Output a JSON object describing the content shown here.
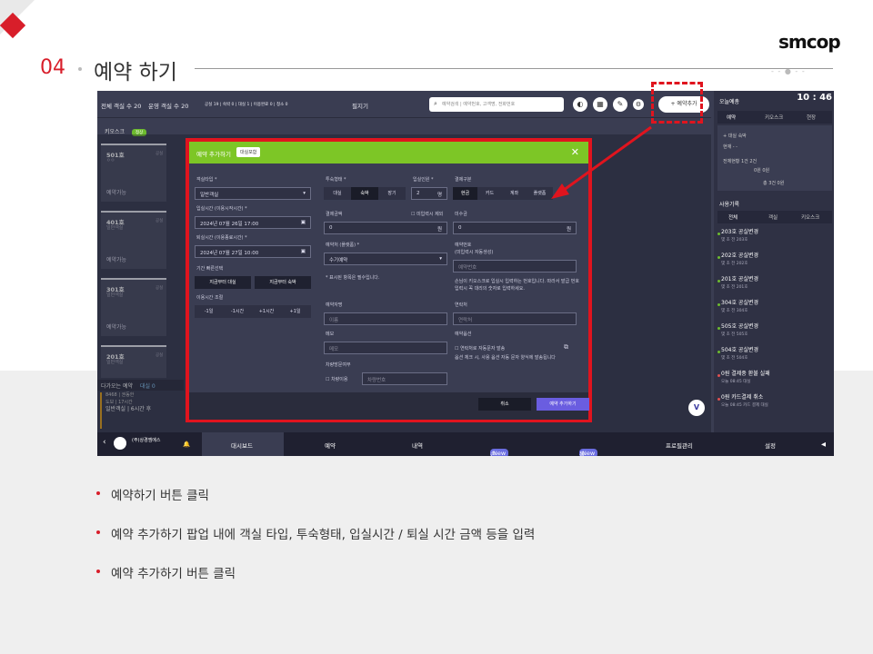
{
  "header": {
    "section_number": "04",
    "section_title": "예약 하기",
    "logo": "smcop"
  },
  "shot": {
    "topbar": {
      "total_rooms": "전체 객실 수 20",
      "operating_rooms": "운영 객실 수 20",
      "stats": "공실 19 | 숙박 0 | 대실 1 | 이용완료 0 | 청소 0",
      "filter": "필지기",
      "search_placeholder": "예약검색 | 예약번호, 고객명, 전화번호",
      "add_reservation": "+ 예약추가"
    },
    "kiosk": {
      "label": "키오스크",
      "badge": "정상"
    },
    "rooms": [
      {
        "no": "501호",
        "type": "ㅇㅇ",
        "state": "공실",
        "status": "예약가능"
      },
      {
        "no": "401호",
        "type": "일반객실",
        "state": "공실",
        "status": "예약가능"
      },
      {
        "no": "301호",
        "type": "일반객실",
        "state": "공실",
        "status": "예약가능"
      },
      {
        "no": "201호",
        "type": "일반객실",
        "state": "공실",
        "status": ""
      }
    ],
    "upcoming": {
      "label": "다가오는 예약",
      "count": "대실 0",
      "lines": [
        "8468 | 권동한",
        "도보 | 17시간",
        "일반객실 | 6시간 후"
      ]
    },
    "nav": {
      "company": "(주)상경엠에스",
      "items": [
        "대시보드",
        "예약",
        "내역",
        "손익",
        "통계",
        "프로필관리",
        "설정"
      ],
      "new_badge": "New"
    },
    "right": {
      "today": "오늘예총",
      "clock": "10 : 46",
      "tabs": [
        "예약",
        "키오스크",
        "현장"
      ],
      "table_rows": [
        "+ 대실 숙박",
        "현재 - -",
        "전체현황 1건 2건",
        "0원 0원",
        "총 3건 0원"
      ],
      "history_title": "사용기록",
      "history_tabs": [
        "전체",
        "객실",
        "키오스크"
      ],
      "history": [
        {
          "title": "203호 공실변경",
          "sub": "몇 초 전  203호"
        },
        {
          "title": "202호 공실변경",
          "sub": "몇 초 전  202호"
        },
        {
          "title": "201호 공실변경",
          "sub": "몇 초 전  201호"
        },
        {
          "title": "304호 공실변경",
          "sub": "몇 초 전  304호"
        },
        {
          "title": "505호 공실변경",
          "sub": "몇 초 전  505호"
        },
        {
          "title": "504호 공실변경",
          "sub": "몇 초 전  504호"
        },
        {
          "title": "0원 결제중 환불 실패",
          "sub": "오늘 08:45  대실"
        },
        {
          "title": "0원 카드결제 취소",
          "sub": "오늘 08:45  카드 결제  대실"
        }
      ]
    },
    "modal": {
      "title": "예약 추가하기",
      "badge": "대실포함",
      "room_type_label": "객실타입 *",
      "room_type_value": "일반객실",
      "checkin_label": "입실시간 (이용시작시간) *",
      "checkin_value": "2024년 07월 26일 17:00",
      "checkout_label": "퇴실시간 (이용종료시간) *",
      "checkout_value": "2024년 07월 27일 10:00",
      "quick_label": "기간 빠른선택",
      "quick_day": "지금부터 대실",
      "quick_night": "지금부터 숙박",
      "adjust_label": "이용시간 조절",
      "adjust": [
        "-1일",
        "-1시간",
        "+1시간",
        "+1일"
      ],
      "stay_label": "투숙형태 *",
      "stay_opts": [
        "대실",
        "숙박",
        "장기"
      ],
      "guests_label": "입실인원 *",
      "guests_value": "2",
      "guests_unit": "명",
      "pay_label": "결제구분",
      "pay_opts": [
        "현금",
        "카드",
        "계좌",
        "플랫폼"
      ],
      "amount_label": "결제금액",
      "amount_value": "0",
      "unit_won": "원",
      "partial_label": "미입력시 제외",
      "unpaid_label": "미수금",
      "unpaid_value": "0",
      "channel_label": "예약처 (플랫폼) *",
      "channel_value": "수기예약",
      "resno_label": "예약번호",
      "resno_sub": "(미입력시 자동생성)",
      "resno_placeholder": "예약번호",
      "required_note": "* 표시된 항목은 필수입니다.",
      "kiosk_note": "손님이 키오스크로 입실시 입력하는 번호입니다. 따라서 발급 번호 입력시 꼭 대리의 숫자로 입력하세요.",
      "name_label": "예약자명",
      "name_placeholder": "이름",
      "phone_label": "연락처",
      "phone_placeholder": "연락처",
      "memo_label": "메모",
      "memo_placeholder": "메모",
      "option_label": "예약옵션",
      "sms_label": "연락처로 자동문자 발송",
      "sms_note": "옵션 체크 시, 사용 옵션 자동 문자 양식에 발송됩니다",
      "car_label": "차량방문여부",
      "car_check": "차량이용",
      "car_placeholder": "차량번호",
      "cancel": "취소",
      "confirm": "예약 추가하기"
    }
  },
  "bullets": [
    "예약하기 버튼 클릭",
    "예약 추가하기 팝업 내에 객실 타입, 투숙형태, 입실시간 / 퇴실 시간 금액 등을 입력",
    "예약 추가하기 버튼 클릭"
  ]
}
